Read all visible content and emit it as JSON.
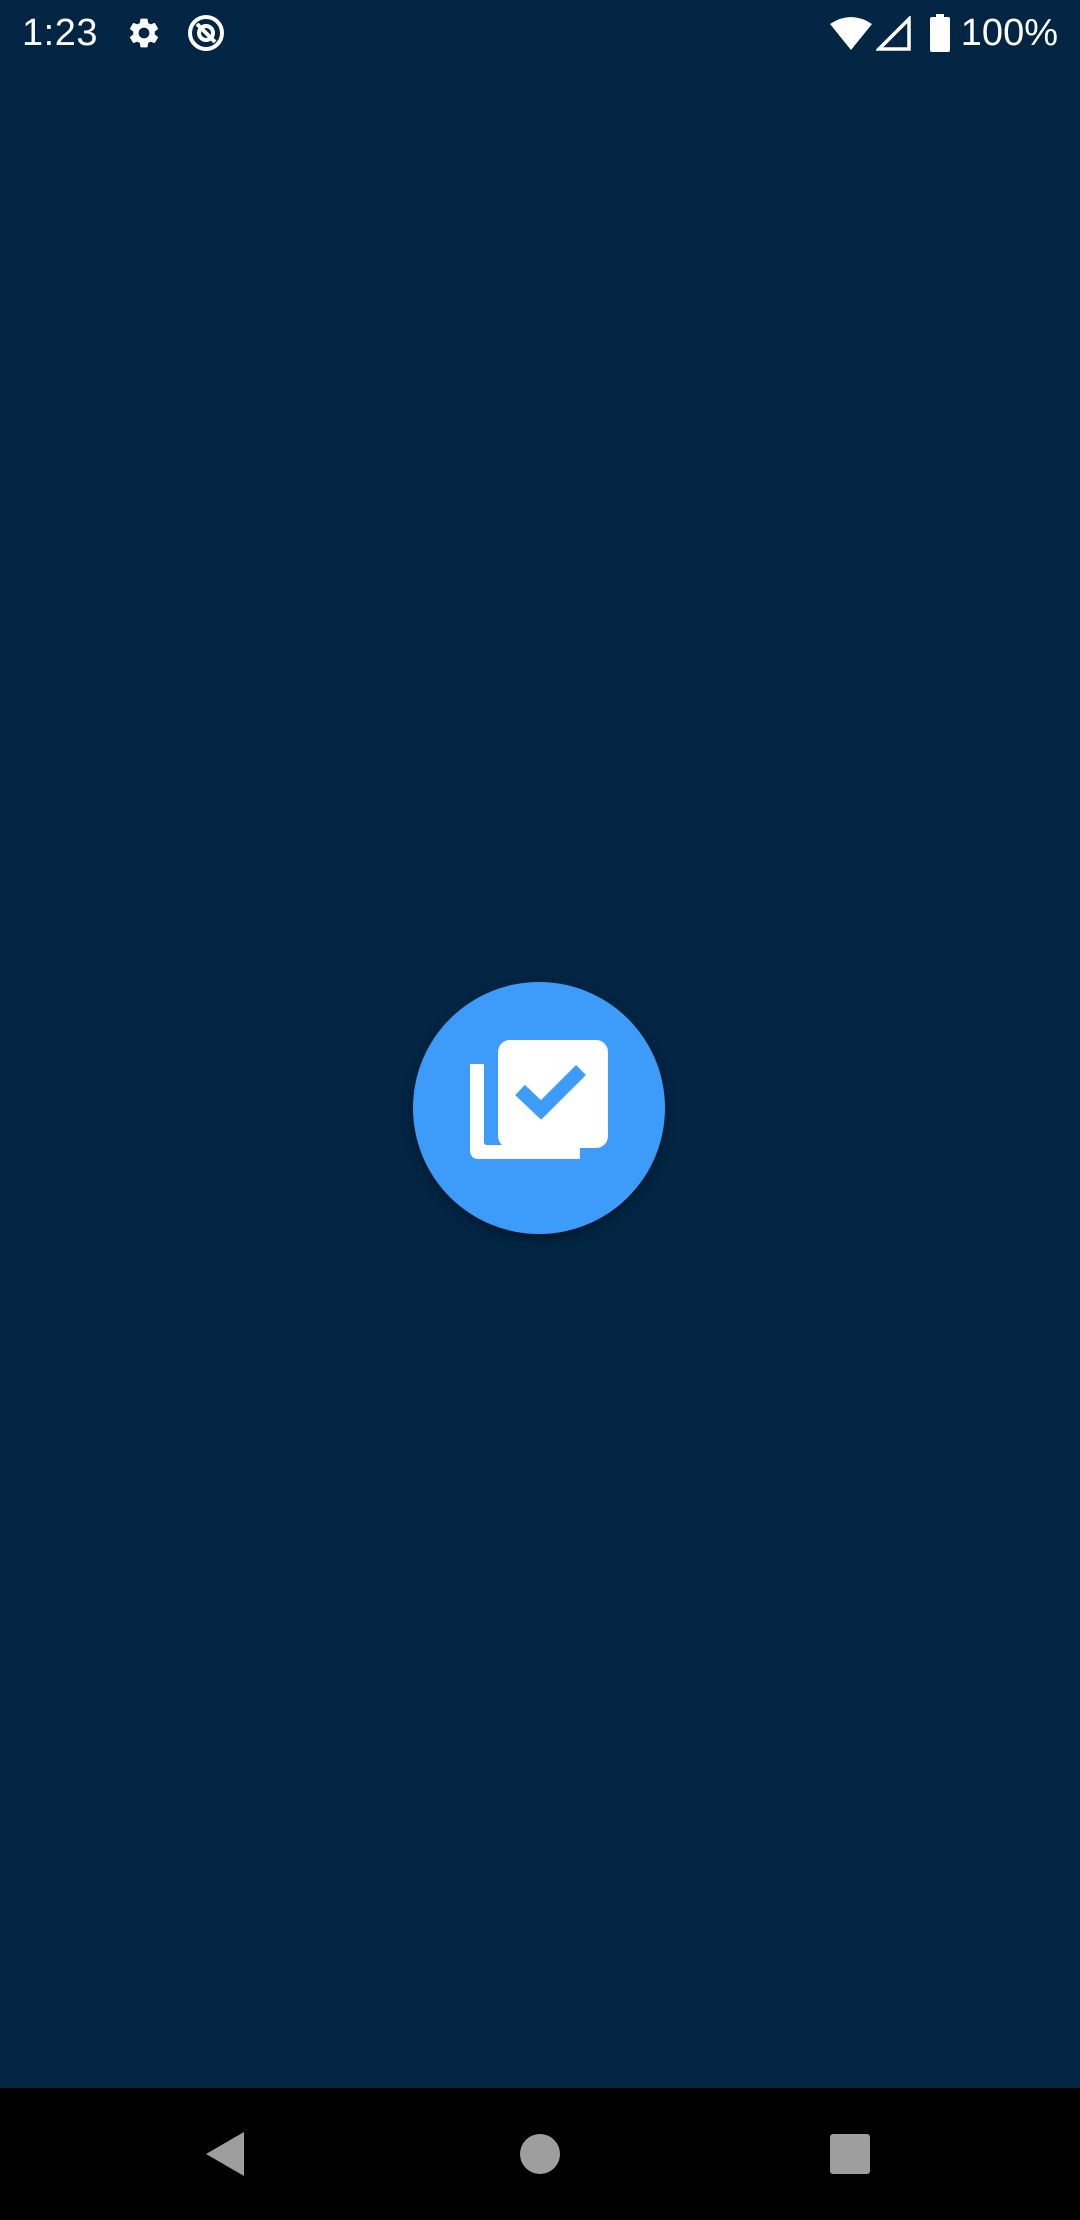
{
  "status_bar": {
    "time": "1:23",
    "battery_text": "100%",
    "icons": [
      "settings-icon",
      "vpn-icon",
      "wifi-icon",
      "cellular-signal-icon",
      "battery-icon"
    ]
  },
  "splash": {
    "logo_icon": "library-add-check-icon",
    "colors": {
      "background": "#022543",
      "logo_circle": "#3d9cf9",
      "logo_glyph": "#ffffff"
    }
  },
  "nav_bar": {
    "buttons": [
      "back-icon",
      "home-icon",
      "recents-icon"
    ],
    "color": "#9e9e9e"
  }
}
